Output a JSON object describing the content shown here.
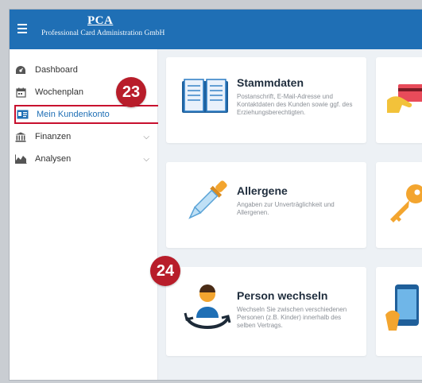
{
  "header": {
    "logo_mark": "PCA",
    "logo_subtitle": "Professional Card Administration GmbH",
    "brand_color": "#1f6fb5"
  },
  "sidebar": {
    "items": [
      {
        "label": "Dashboard",
        "icon": "dashboard-icon"
      },
      {
        "label": "Wochenplan",
        "icon": "calendar-icon"
      },
      {
        "label": "Mein Kundenkonto",
        "icon": "id-card-icon",
        "active": true
      },
      {
        "label": "Finanzen",
        "icon": "bank-icon",
        "expandable": true
      },
      {
        "label": "Analysen",
        "icon": "area-chart-icon",
        "expandable": true
      }
    ]
  },
  "cards": [
    {
      "title": "Stammdaten",
      "description": "Postanschrift, E-Mail-Adresse und Kontaktdaten des Kunden sowie ggf. des Erziehungsberechtigten.",
      "icon": "book-icon"
    },
    {
      "title": "Allergene",
      "description": "Angaben zur Unverträglichkeit und Allergenen.",
      "icon": "dropper-icon"
    },
    {
      "title": "Person wechseln",
      "description": "Wechseln Sie zwischen verschiedenen Personen (z.B. Kinder) innerhalb des selben Vertrags.",
      "icon": "switch-person-icon"
    }
  ],
  "callouts": {
    "first": "23",
    "second": "24",
    "color": "#b81d2a"
  }
}
